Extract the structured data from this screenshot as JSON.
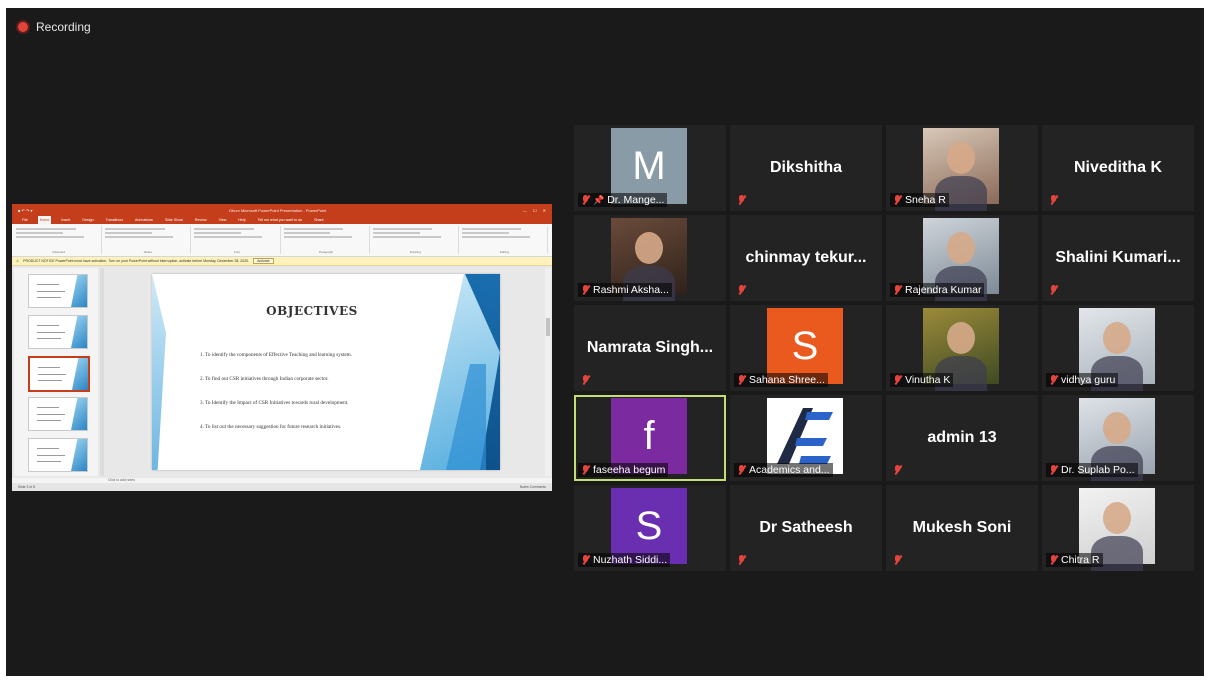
{
  "recording_label": "Recording",
  "presentation": {
    "window_title": "Dhurv Microsoft PowerPoint Presentation - PowerPoint",
    "tabs": [
      "File",
      "Home",
      "Insert",
      "Design",
      "Transitions",
      "Animations",
      "Slide Show",
      "Review",
      "View",
      "Help",
      "Tell me what you want to do",
      "Share"
    ],
    "ribbon_groups": [
      "Clipboard",
      "Slides",
      "Font",
      "Paragraph",
      "Drawing",
      "Editing"
    ],
    "notice": "PRODUCT NOTICE  PowerPoint must have activation. Turn on your PowerPoint without interruption, activate before Monday, December 28, 2020.",
    "notice_button": "Activate",
    "slide_title": "OBJECTIVES",
    "objectives": [
      "1. To identify the components of Effective Teaching and learning system.",
      "2. To find out CSR initiatives through Indian corporate sector.",
      "3. To Identify the Impact of CSR Initiatives towards rural development.",
      "4. To list out the necessary suggestion for future research initiatives."
    ],
    "notes_placeholder": "Click to add notes",
    "status_left": "Slide 3 of 8",
    "status_right": "Notes  Comments"
  },
  "participants": [
    {
      "name": "Dr. Mange...",
      "type": "avatar",
      "initial": "M",
      "color": "#8a9ba8",
      "pinned": true
    },
    {
      "name": "Dikshitha",
      "type": "name"
    },
    {
      "name": "Sneha R",
      "type": "photo"
    },
    {
      "name": "Niveditha K",
      "type": "name"
    },
    {
      "name": "Rashmi Aksha...",
      "type": "photo"
    },
    {
      "name": "chinmay tekur...",
      "type": "name"
    },
    {
      "name": "Rajendra Kumar",
      "type": "photo"
    },
    {
      "name": "Shalini Kumari...",
      "type": "name"
    },
    {
      "name": "Namrata Singh...",
      "type": "name"
    },
    {
      "name": "Sahana Shree...",
      "type": "avatar",
      "initial": "S",
      "color": "#ea5a1f"
    },
    {
      "name": "Vinutha K",
      "type": "photo"
    },
    {
      "name": "vidhya guru",
      "type": "photo"
    },
    {
      "name": "faseeha begum",
      "type": "avatar",
      "initial": "f",
      "color": "#7b2aa0",
      "active": true
    },
    {
      "name": "Academics and...",
      "type": "logo"
    },
    {
      "name": "admin 13",
      "type": "name"
    },
    {
      "name": "Dr. Suplab Po...",
      "type": "photo"
    },
    {
      "name": "Nuzhath Siddi...",
      "type": "avatar",
      "initial": "S",
      "color": "#6a2fb0"
    },
    {
      "name": "Dr Satheesh",
      "type": "name"
    },
    {
      "name": "Mukesh Soni",
      "type": "name"
    },
    {
      "name": "Chitra R",
      "type": "photo"
    }
  ]
}
